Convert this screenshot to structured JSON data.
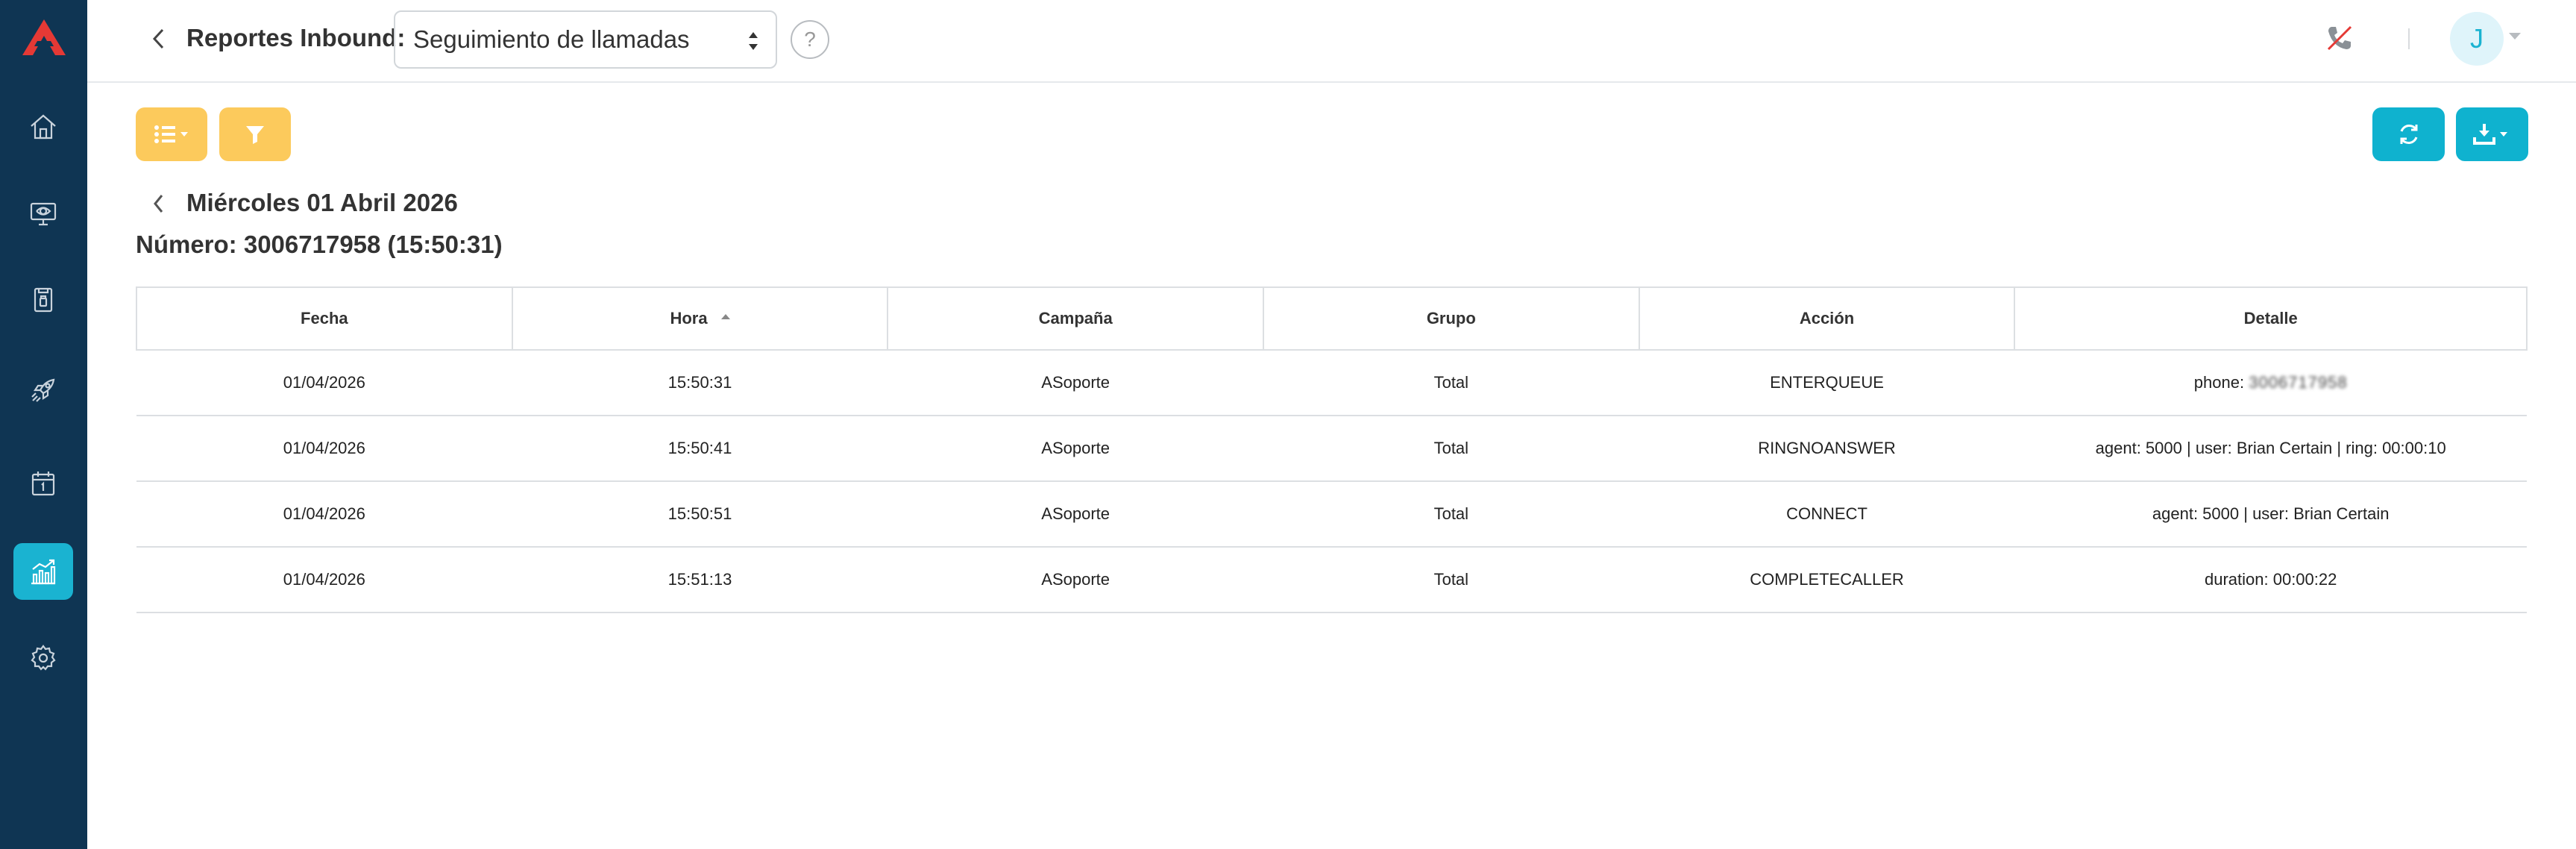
{
  "header": {
    "title": "Reportes Inbound:",
    "report_select": "Seguimiento de llamadas",
    "help_label": "?",
    "avatar_initial": "J"
  },
  "colors": {
    "sidebar_bg": "#0f3553",
    "accent_cyan": "#1ab3d1",
    "accent_yellow": "#fcca5c",
    "logo_red": "#e53935"
  },
  "sidebar": {
    "items": [
      {
        "name": "home-icon",
        "active": false
      },
      {
        "name": "monitor-icon",
        "active": false
      },
      {
        "name": "contacts-book-icon",
        "active": false
      },
      {
        "name": "campaign-rocket-icon",
        "active": false
      },
      {
        "name": "calendar-icon",
        "active": false
      },
      {
        "name": "reports-chart-icon",
        "active": true
      },
      {
        "name": "settings-gear-icon",
        "active": false
      }
    ]
  },
  "toolbar": {
    "columns_button_icon": "list-icon",
    "filter_button_icon": "filter-icon",
    "refresh_button_icon": "refresh-icon",
    "download_button_icon": "download-icon"
  },
  "report": {
    "date_title": "Miércoles 01 Abril 2026",
    "number_title": "Número: 3006717958 (15:50:31)"
  },
  "table": {
    "columns": [
      "Fecha",
      "Hora",
      "Campaña",
      "Grupo",
      "Acción",
      "Detalle"
    ],
    "sorted_column": "Hora",
    "rows": [
      {
        "fecha": "01/04/2026",
        "hora": "15:50:31",
        "campana": "ASoporte",
        "grupo": "Total",
        "accion": "ENTERQUEUE",
        "detalle_prefix": "phone:",
        "detalle_redacted": "3006717958"
      },
      {
        "fecha": "01/04/2026",
        "hora": "15:50:41",
        "campana": "ASoporte",
        "grupo": "Total",
        "accion": "RINGNOANSWER",
        "detalle": "agent: 5000 | user: Brian Certain | ring: 00:00:10"
      },
      {
        "fecha": "01/04/2026",
        "hora": "15:50:51",
        "campana": "ASoporte",
        "grupo": "Total",
        "accion": "CONNECT",
        "detalle": "agent: 5000 | user: Brian Certain"
      },
      {
        "fecha": "01/04/2026",
        "hora": "15:51:13",
        "campana": "ASoporte",
        "grupo": "Total",
        "accion": "COMPLETECALLER",
        "detalle": "duration: 00:00:22"
      }
    ]
  }
}
